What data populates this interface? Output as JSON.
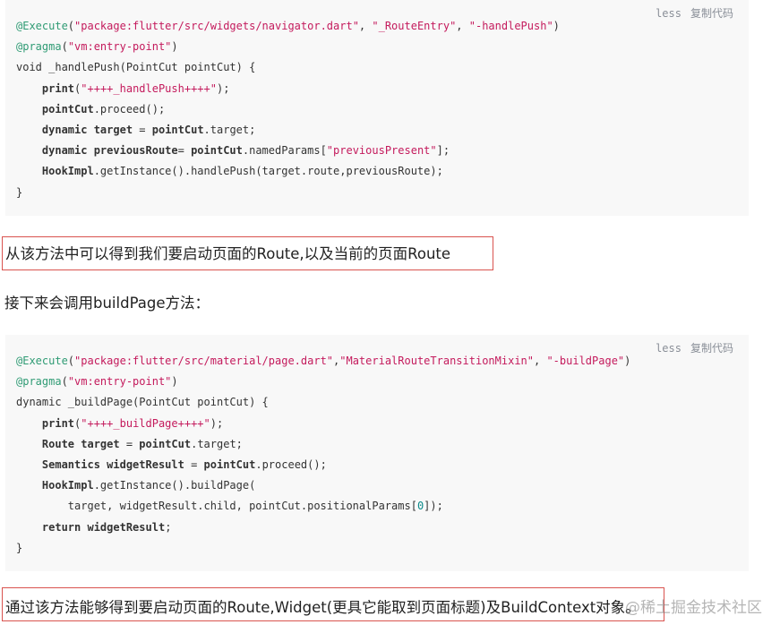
{
  "code_block_1": {
    "lang": "less",
    "copy_label": "复制代码",
    "lines": [
      [
        {
          "c": "t-meta",
          "t": "@Execute"
        },
        {
          "c": "t-plain",
          "t": "("
        },
        {
          "c": "t-str",
          "t": "\"package:flutter/src/widgets/navigator.dart\""
        },
        {
          "c": "t-plain",
          "t": ", "
        },
        {
          "c": "t-str",
          "t": "\"_RouteEntry\""
        },
        {
          "c": "t-plain",
          "t": ", "
        },
        {
          "c": "t-str",
          "t": "\"-handlePush\""
        },
        {
          "c": "t-plain",
          "t": ")"
        }
      ],
      [
        {
          "c": "t-meta",
          "t": "@pragma"
        },
        {
          "c": "t-plain",
          "t": "("
        },
        {
          "c": "t-str",
          "t": "\"vm:entry-point\""
        },
        {
          "c": "t-plain",
          "t": ")"
        }
      ],
      [
        {
          "c": "t-plain",
          "t": "void _handlePush(PointCut pointCut) {"
        }
      ],
      [
        {
          "c": "t-plain",
          "t": "    "
        },
        {
          "c": "t-kw",
          "t": "print"
        },
        {
          "c": "t-plain",
          "t": "("
        },
        {
          "c": "t-str",
          "t": "\"++++_handlePush++++\""
        },
        {
          "c": "t-plain",
          "t": ");"
        }
      ],
      [
        {
          "c": "t-plain",
          "t": "    "
        },
        {
          "c": "t-kw",
          "t": "pointCut"
        },
        {
          "c": "t-plain",
          "t": ".proceed();"
        }
      ],
      [
        {
          "c": "t-plain",
          "t": "    "
        },
        {
          "c": "t-kw",
          "t": "dynamic target"
        },
        {
          "c": "t-plain",
          "t": " = "
        },
        {
          "c": "t-kw",
          "t": "pointCut"
        },
        {
          "c": "t-plain",
          "t": ".target;"
        }
      ],
      [
        {
          "c": "t-plain",
          "t": "    "
        },
        {
          "c": "t-kw",
          "t": "dynamic previousRoute"
        },
        {
          "c": "t-plain",
          "t": "= "
        },
        {
          "c": "t-kw",
          "t": "pointCut"
        },
        {
          "c": "t-plain",
          "t": ".namedParams["
        },
        {
          "c": "t-str",
          "t": "\"previousPresent\""
        },
        {
          "c": "t-plain",
          "t": "];"
        }
      ],
      [
        {
          "c": "t-plain",
          "t": "    "
        },
        {
          "c": "t-kw",
          "t": "HookImpl"
        },
        {
          "c": "t-plain",
          "t": ".getInstance().handlePush(target.route,previousRoute);"
        }
      ],
      [
        {
          "c": "t-plain",
          "t": "}"
        }
      ]
    ]
  },
  "para_1": "从该方法中可以得到我们要启动页面的Route,以及当前的页面Route",
  "para_2": "接下来会调用buildPage方法：",
  "code_block_2": {
    "lang": "less",
    "copy_label": "复制代码",
    "lines": [
      [
        {
          "c": "t-meta",
          "t": "@Execute"
        },
        {
          "c": "t-plain",
          "t": "("
        },
        {
          "c": "t-str",
          "t": "\"package:flutter/src/material/page.dart\""
        },
        {
          "c": "t-plain",
          "t": ","
        },
        {
          "c": "t-str",
          "t": "\"MaterialRouteTransitionMixin\""
        },
        {
          "c": "t-plain",
          "t": ", "
        },
        {
          "c": "t-str",
          "t": "\"-buildPage\""
        },
        {
          "c": "t-plain",
          "t": ")"
        }
      ],
      [
        {
          "c": "t-meta",
          "t": "@pragma"
        },
        {
          "c": "t-plain",
          "t": "("
        },
        {
          "c": "t-str",
          "t": "\"vm:entry-point\""
        },
        {
          "c": "t-plain",
          "t": ")"
        }
      ],
      [
        {
          "c": "t-plain",
          "t": "dynamic _buildPage(PointCut pointCut) {"
        }
      ],
      [
        {
          "c": "t-plain",
          "t": "    "
        },
        {
          "c": "t-kw",
          "t": "print"
        },
        {
          "c": "t-plain",
          "t": "("
        },
        {
          "c": "t-str",
          "t": "\"++++_buildPage++++\""
        },
        {
          "c": "t-plain",
          "t": ");"
        }
      ],
      [
        {
          "c": "t-plain",
          "t": "    "
        },
        {
          "c": "t-kw",
          "t": "Route target"
        },
        {
          "c": "t-plain",
          "t": " = "
        },
        {
          "c": "t-kw",
          "t": "pointCut"
        },
        {
          "c": "t-plain",
          "t": ".target;"
        }
      ],
      [
        {
          "c": "t-plain",
          "t": "    "
        },
        {
          "c": "t-kw",
          "t": "Semantics widgetResult"
        },
        {
          "c": "t-plain",
          "t": " = "
        },
        {
          "c": "t-kw",
          "t": "pointCut"
        },
        {
          "c": "t-plain",
          "t": ".proceed();"
        }
      ],
      [
        {
          "c": "t-plain",
          "t": "    "
        },
        {
          "c": "t-kw",
          "t": "HookImpl"
        },
        {
          "c": "t-plain",
          "t": ".getInstance().buildPage("
        }
      ],
      [
        {
          "c": "t-plain",
          "t": "        target, widgetResult.child, pointCut.positionalParams["
        },
        {
          "c": "t-num",
          "t": "0"
        },
        {
          "c": "t-plain",
          "t": "]);"
        }
      ],
      [
        {
          "c": "t-plain",
          "t": "    "
        },
        {
          "c": "t-kw",
          "t": "return widgetResult"
        },
        {
          "c": "t-plain",
          "t": ";"
        }
      ],
      [
        {
          "c": "t-plain",
          "t": "}"
        }
      ]
    ]
  },
  "para_3": "通过该方法能够得到要启动页面的Route,Widget(更具它能取到页面标题)及BuildContext对象。",
  "watermark": "@稀土掘金技术社区"
}
